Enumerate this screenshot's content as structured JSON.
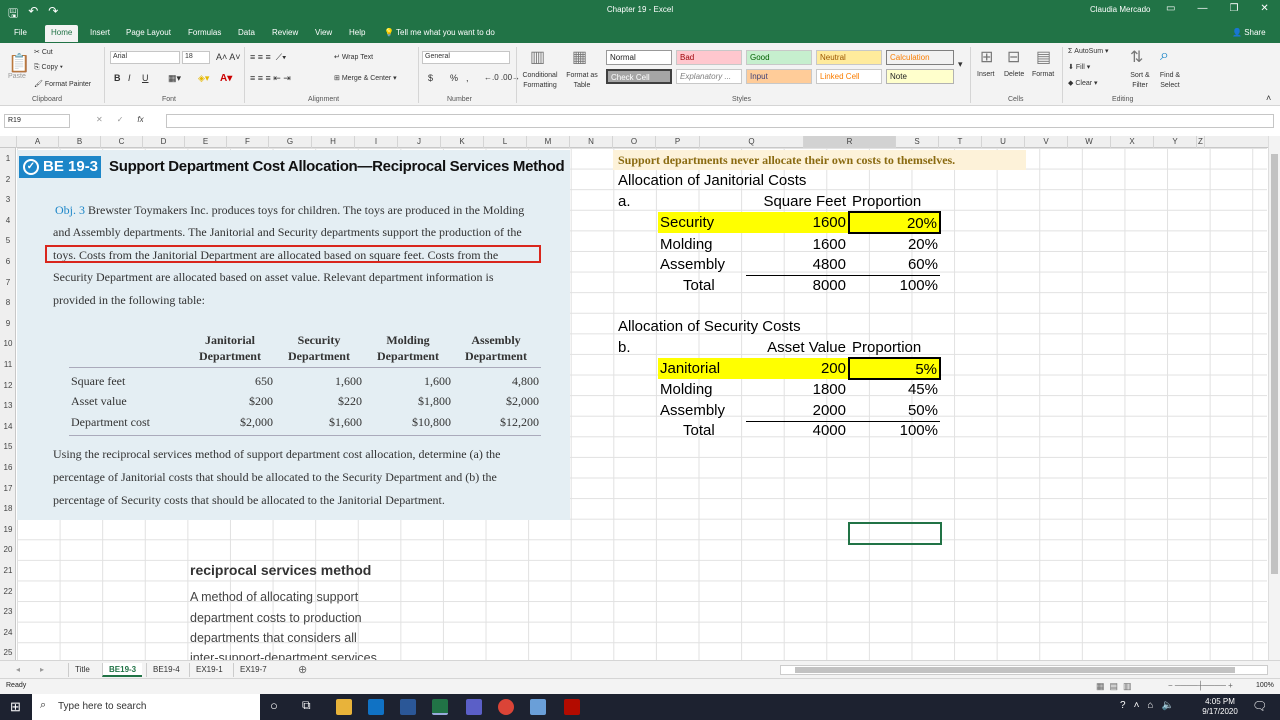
{
  "window": {
    "title": "Chapter 19  -  Excel",
    "user": "Claudia Mercado",
    "share": "Share"
  },
  "qat": {
    "save": "🖫",
    "undo": "↶",
    "redo": "↷"
  },
  "ribbon_tabs": [
    "File",
    "Home",
    "Insert",
    "Page Layout",
    "Formulas",
    "Data",
    "Review",
    "View",
    "Help",
    "Tell me what you want to do"
  ],
  "clipboard": {
    "cut": "Cut",
    "copy": "Copy",
    "paint": "Format Painter",
    "paste": "Paste",
    "label": "Clipboard"
  },
  "font": {
    "name": "Arial",
    "size": "18",
    "label": "Font",
    "bold": "B",
    "italic": "I",
    "underline": "U"
  },
  "alignment": {
    "wrap": "Wrap Text",
    "merge": "Merge & Center",
    "label": "Alignment"
  },
  "number": {
    "format": "General",
    "label": "Number",
    "currency": "$",
    "percent": "%",
    "comma": ","
  },
  "styles_group": {
    "conditional": "Conditional Formatting",
    "format_table": "Format as Table",
    "label": "Styles",
    "cells": [
      "Normal",
      "Bad",
      "Good",
      "Neutral",
      "Calculation",
      "Check Cell",
      "Explanatory ...",
      "Input",
      "Linked Cell",
      "Note"
    ]
  },
  "cells_group": {
    "insert": "Insert",
    "delete": "Delete",
    "format": "Format",
    "label": "Cells"
  },
  "editing": {
    "autosum": "AutoSum",
    "fill": "Fill",
    "clear": "Clear",
    "sort": "Sort & Filter",
    "find": "Find & Select",
    "label": "Editing"
  },
  "formula_bar": {
    "name_box": "R19",
    "value": ""
  },
  "columns": [
    "A",
    "B",
    "C",
    "D",
    "E",
    "F",
    "G",
    "H",
    "I",
    "J",
    "K",
    "L",
    "M",
    "N",
    "O",
    "P",
    "Q",
    "R",
    "S",
    "T",
    "U",
    "V",
    "W",
    "X",
    "Y",
    "Z"
  ],
  "rows": [
    "1",
    "2",
    "3",
    "4",
    "5",
    "6",
    "7",
    "8",
    "9",
    "10",
    "11",
    "12",
    "13",
    "14",
    "15",
    "16",
    "17",
    "18",
    "19",
    "20",
    "21",
    "22",
    "23",
    "24",
    "25"
  ],
  "problem": {
    "badge": "BE 19-3",
    "title": "Support Department Cost Allocation—Reciprocal Services Method",
    "obj": "Obj. 3",
    "lines": [
      "Brewster Toymakers Inc. produces toys for children. The toys are produced in the Molding",
      "and Assembly departments. The Janitorial and Security departments support the production of the",
      "toys. Costs from the Janitorial Department are allocated based on square feet. Costs from the",
      "Security Department are allocated based on asset value. Relevant department information is",
      "provided in the following table:"
    ],
    "table": {
      "headers": [
        [
          "Janitorial",
          "Department"
        ],
        [
          "Security",
          "Department"
        ],
        [
          "Molding",
          "Department"
        ],
        [
          "Assembly",
          "Department"
        ]
      ],
      "rows": [
        {
          "label": "Square feet",
          "values": [
            "650",
            "1,600",
            "1,600",
            "4,800"
          ]
        },
        {
          "label": "Asset value",
          "values": [
            "$200",
            "$220",
            "$1,800",
            "$2,000"
          ]
        },
        {
          "label": "Department cost",
          "values": [
            "$2,000",
            "$1,600",
            "$10,800",
            "$12,200"
          ]
        }
      ]
    },
    "question": [
      "Using the reciprocal services method of support department cost allocation, determine (a) the",
      "percentage of Janitorial costs that should be allocated to the Security Department and (b) the",
      "percentage of Security costs that should be allocated to the Janitorial Department."
    ]
  },
  "note": "Support departments never allocate their own costs to themselves.",
  "section_a": {
    "title": "Allocation of Janitorial Costs",
    "letter": "a.",
    "h1": "Square Feet",
    "h2": "Proportion",
    "rows": [
      {
        "name": "Security",
        "value": "1600",
        "prop": "20%"
      },
      {
        "name": "Molding",
        "value": "1600",
        "prop": "20%"
      },
      {
        "name": "Assembly",
        "value": "4800",
        "prop": "60%"
      },
      {
        "name": "Total",
        "value": "8000",
        "prop": "100%"
      }
    ]
  },
  "section_b": {
    "title": "Allocation of Security Costs",
    "letter": "b.",
    "h1": "Asset Value",
    "h2": "Proportion",
    "rows": [
      {
        "name": "Janitorial",
        "value": "200",
        "prop": "5%"
      },
      {
        "name": "Molding",
        "value": "1800",
        "prop": "45%"
      },
      {
        "name": "Assembly",
        "value": "2000",
        "prop": "50%"
      },
      {
        "name": "Total",
        "value": "4000",
        "prop": "100%"
      }
    ]
  },
  "glossary": {
    "term": "reciprocal services method",
    "lines": [
      "A method of allocating support",
      "department costs to production",
      "departments that considers all",
      "inter-support-department services"
    ]
  },
  "sheet_tabs": [
    "Title",
    "BE19-3",
    "BE19-4",
    "EX19-1",
    "EX19-7"
  ],
  "status": {
    "ready": "Ready",
    "zoom": "100%"
  },
  "taskbar": {
    "search": "Type here to search",
    "time": "4:05 PM",
    "date": "9/17/2020"
  }
}
